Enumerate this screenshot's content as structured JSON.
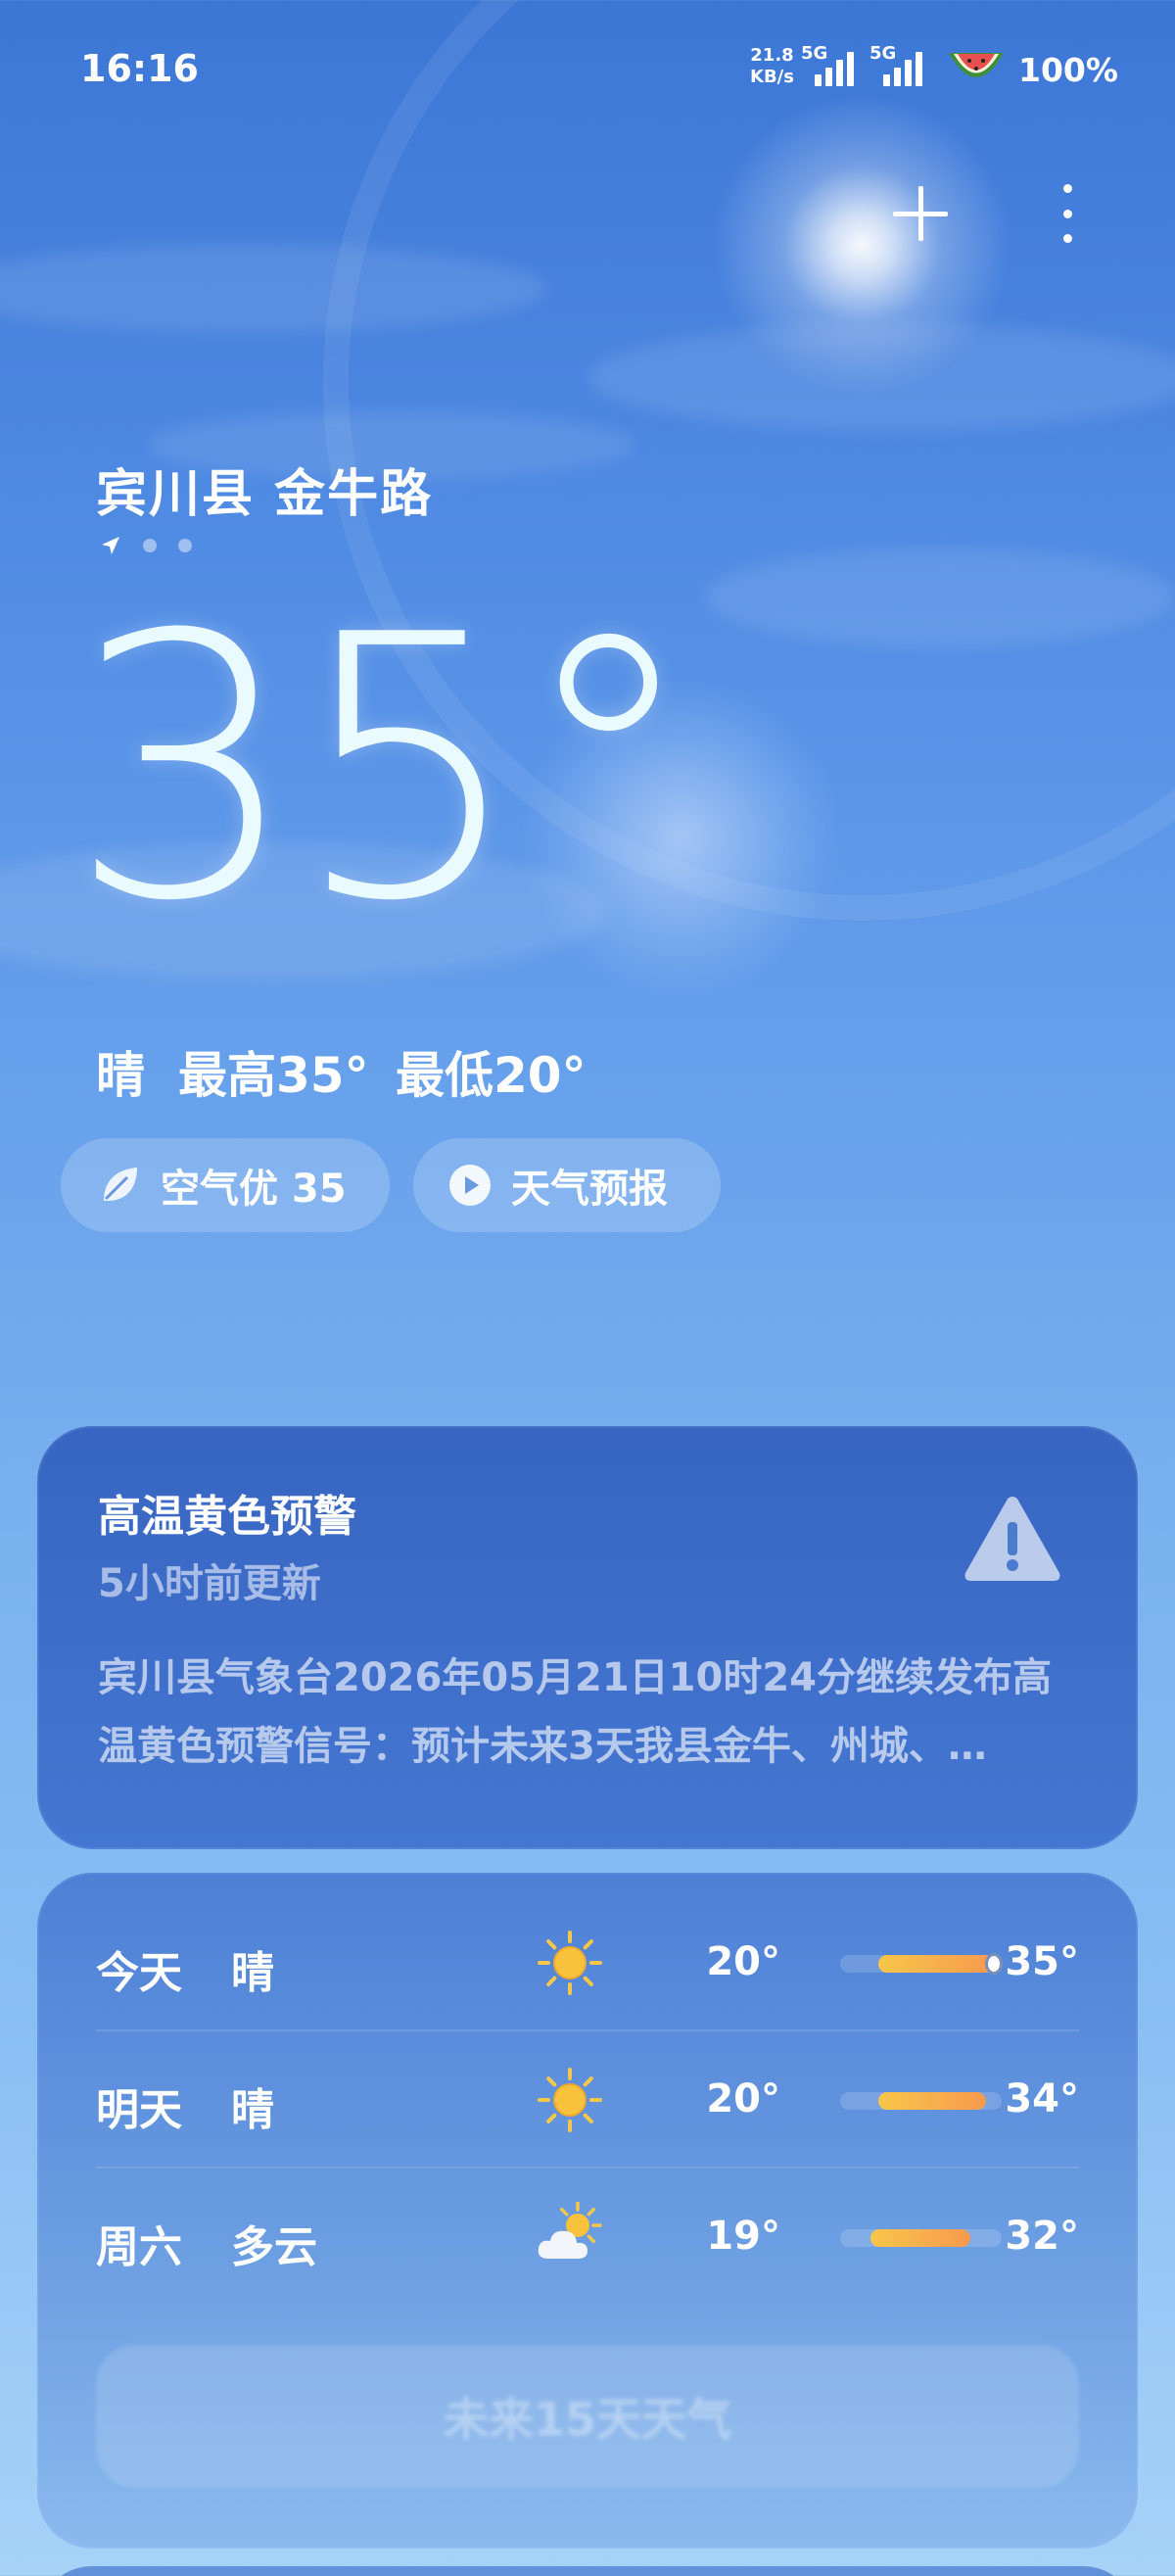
{
  "status_bar": {
    "time": "16:16",
    "net_speed_value": "21.8",
    "net_speed_unit": "KB/s",
    "sim1_label": "5G",
    "sim2_label": "5G",
    "battery": "100%"
  },
  "location": {
    "name": "宾川县 金牛路",
    "pages": 3,
    "current_page": 1
  },
  "current": {
    "temperature": "35°",
    "condition": "晴",
    "high": "最高35°",
    "low": "最低20°"
  },
  "chips": {
    "air_quality": "空气优 35",
    "forecast_video": "天气预报"
  },
  "alert": {
    "title": "高温黄色预警",
    "updated": "5小时前更新",
    "body": "宾川县气象台2026年05月21日10时24分继续发布高温黄色预警信号：预计未来3天我县金牛、州城、…"
  },
  "forecast": {
    "days": [
      {
        "day": "今天",
        "condition": "晴",
        "icon": "sun-icon",
        "low": "20°",
        "high": "35°",
        "low_value": 20,
        "high_value": 35,
        "current_value": 35
      },
      {
        "day": "明天",
        "condition": "晴",
        "icon": "sun-icon",
        "low": "20°",
        "high": "34°",
        "low_value": 20,
        "high_value": 34
      },
      {
        "day": "周六",
        "condition": "多云",
        "icon": "partly-cloudy-icon",
        "low": "19°",
        "high": "32°",
        "low_value": 19,
        "high_value": 32
      }
    ],
    "range_min": 15,
    "range_max": 36,
    "more_button": "未来15天天气"
  },
  "colors": {
    "sky_top": "#3d77d6",
    "sky_bottom": "#a6d2f8",
    "range_start": "#f8c64a",
    "range_end": "#f79a4e",
    "sun": "#f9c23c"
  }
}
